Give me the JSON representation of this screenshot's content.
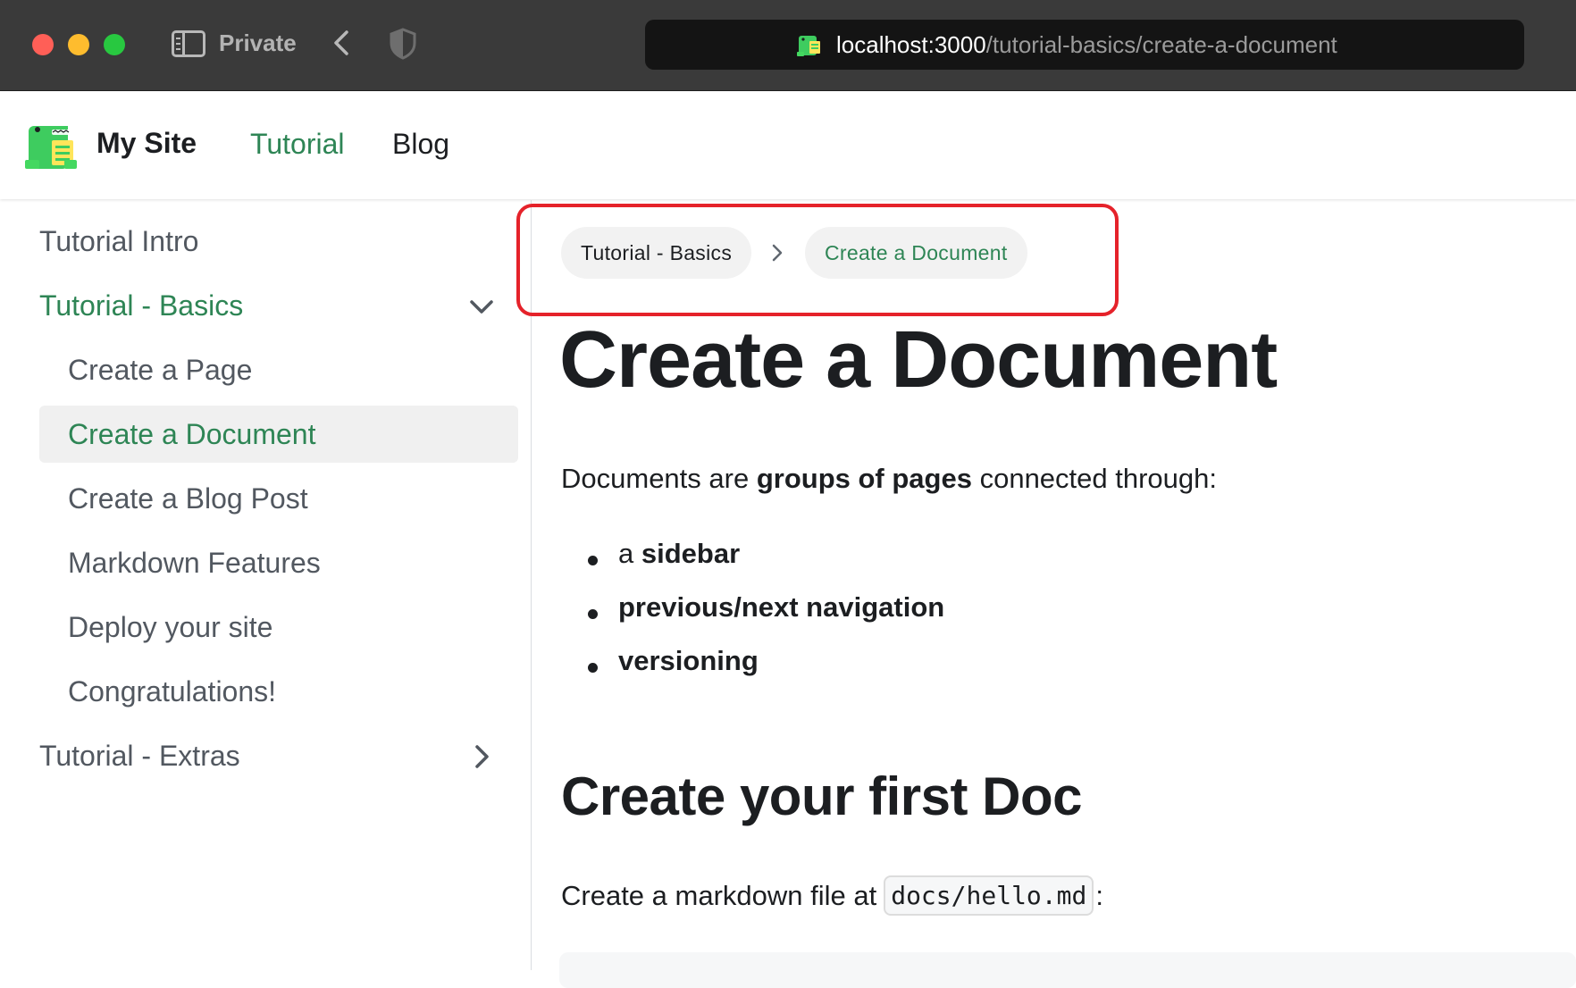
{
  "browser": {
    "private_label": "Private",
    "url_host": "localhost:3000",
    "url_path": "/tutorial-basics/create-a-document"
  },
  "navbar": {
    "site_title": "My Site",
    "links": [
      {
        "label": "Tutorial",
        "active": true
      },
      {
        "label": "Blog",
        "active": false
      }
    ]
  },
  "sidebar": {
    "items": [
      {
        "label": "Tutorial Intro"
      },
      {
        "label": "Tutorial - Basics",
        "expanded": true
      },
      {
        "label": "Create a Page"
      },
      {
        "label": "Create a Document",
        "active": true
      },
      {
        "label": "Create a Blog Post"
      },
      {
        "label": "Markdown Features"
      },
      {
        "label": "Deploy your site"
      },
      {
        "label": "Congratulations!"
      },
      {
        "label": "Tutorial - Extras",
        "expanded": false
      }
    ]
  },
  "breadcrumbs": [
    {
      "label": "Tutorial - Basics"
    },
    {
      "label": "Create a Document",
      "current": true
    }
  ],
  "content": {
    "title": "Create a Document",
    "intro_prefix": "Documents are ",
    "intro_bold": "groups of pages",
    "intro_suffix": " connected through:",
    "bullets": [
      {
        "prefix": "a ",
        "bold": "sidebar"
      },
      {
        "prefix": "",
        "bold": "previous/next navigation"
      },
      {
        "prefix": "",
        "bold": "versioning"
      }
    ],
    "h2": "Create your first Doc",
    "para2_prefix": "Create a markdown file at",
    "para2_code": "docs/hello.md",
    "para2_suffix": ":"
  },
  "colors": {
    "accent": "#2e8555",
    "highlight": "#e5222a"
  }
}
